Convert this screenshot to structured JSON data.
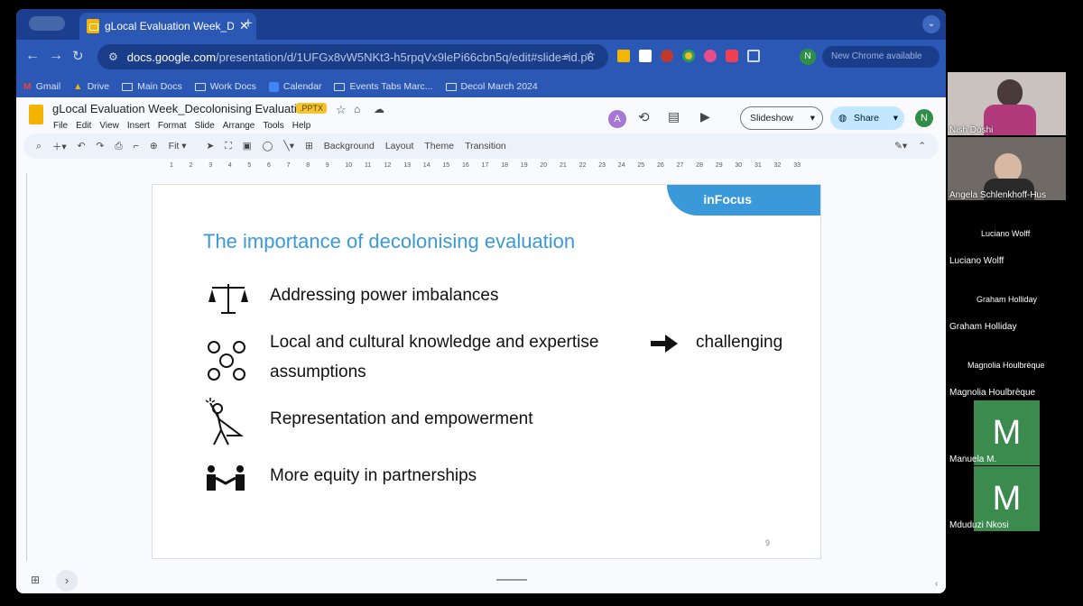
{
  "browser": {
    "tab_title": "gLocal Evaluation Week_Decolonising Evaluation",
    "url_host": "docs.google.com",
    "url_path": "/presentation/d/1UFGx8vW5NKt3-h5rpqVx9lePi66cbn5q/edit#slide=id.p6",
    "new_chrome": "New Chrome available",
    "profile_initial": "N",
    "bookmarks": [
      "Gmail",
      "Drive",
      "Main Docs",
      "Work Docs",
      "Calendar",
      "Events Tabs Marc...",
      "Decol March 2024"
    ]
  },
  "docs": {
    "title": "gLocal Evaluation Week_Decolonising Evaluation",
    "badge": ".PPTX",
    "menus": [
      "File",
      "Edit",
      "View",
      "Insert",
      "Format",
      "Slide",
      "Arrange",
      "Tools",
      "Help"
    ],
    "avatar_a": "A",
    "avatar_n": "N",
    "slideshow": "Slideshow",
    "share": "Share",
    "zoom": "Fit",
    "toolbar_text": [
      "Background",
      "Layout",
      "Theme",
      "Transition"
    ]
  },
  "ruler": [
    "1",
    "2",
    "3",
    "4",
    "5",
    "6",
    "7",
    "8",
    "9",
    "10",
    "11",
    "12",
    "13",
    "14",
    "15",
    "16",
    "17",
    "18",
    "19",
    "20",
    "21",
    "22",
    "23",
    "24",
    "25",
    "26",
    "27",
    "28",
    "29",
    "30",
    "31",
    "32",
    "33"
  ],
  "slide": {
    "brand": "inFocus",
    "title": "The importance of decolonising evaluation",
    "bullets": [
      "Addressing power imbalances",
      "Local and cultural knowledge and expertise",
      "Representation and empowerment",
      "More equity in partnerships"
    ],
    "bullet2_tail": "challenging",
    "bullet2_line2": "assumptions",
    "page_number": "9"
  },
  "participants": {
    "p1": "Nish Doshi",
    "p2": "Angela Schlenkhoff-Hus",
    "p3_center": "Luciano Wolff",
    "p3": "Luciano Wolff",
    "p4_center": "Graham Holliday",
    "p4": "Graham Holliday",
    "p5_center": "Magnolia Houlbrèque",
    "p5": "Magnolia Houlbrèque",
    "p6_letter": "M",
    "p6": "Manuela M.",
    "p7_letter": "M",
    "p7": "Mduduzi Nkosi"
  },
  "colors": {
    "title": "#3a9ad9",
    "brand_bg": "#3a9ad9",
    "tile_green": "#3b8a4e"
  }
}
